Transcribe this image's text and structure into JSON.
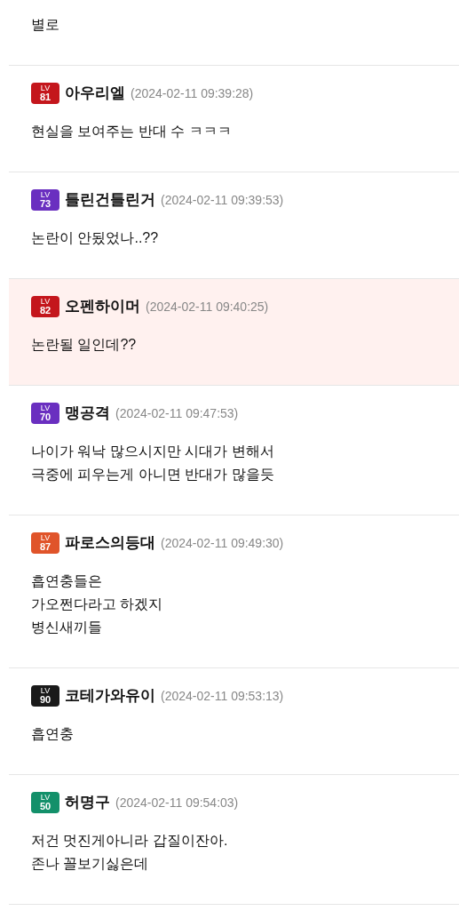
{
  "top_fragment": {
    "lines": [
      "별로"
    ]
  },
  "comments": [
    {
      "badge": {
        "label": "LV",
        "level": "81",
        "color": "#c4161c"
      },
      "name": "아우리엘",
      "time": "(2024-02-11 09:39:28)",
      "lines": [
        "현실을 보여주는 반대 수 ㅋㅋㅋ"
      ],
      "highlighted": false
    },
    {
      "badge": {
        "label": "LV",
        "level": "73",
        "color": "#6a2fc0"
      },
      "name": "틀린건틀린거",
      "time": "(2024-02-11 09:39:53)",
      "lines": [
        "논란이 안됬었나..??"
      ],
      "highlighted": false
    },
    {
      "badge": {
        "label": "LV",
        "level": "82",
        "color": "#c4161c"
      },
      "name": "오펜하이머",
      "time": "(2024-02-11 09:40:25)",
      "lines": [
        "논란될 일인데??"
      ],
      "highlighted": true
    },
    {
      "badge": {
        "label": "LV",
        "level": "70",
        "color": "#6a2fc0"
      },
      "name": "맹공격",
      "time": "(2024-02-11 09:47:53)",
      "lines": [
        "나이가 워낙 많으시지만 시대가 변해서",
        "극중에 피우는게 아니면 반대가 많을듯"
      ],
      "highlighted": false
    },
    {
      "badge": {
        "label": "LV",
        "level": "87",
        "color": "#e0542a"
      },
      "name": "파로스의등대",
      "time": "(2024-02-11 09:49:30)",
      "lines": [
        "흡연충들은",
        "가오쩐다라고 하겠지",
        "병신새끼들"
      ],
      "highlighted": false
    },
    {
      "badge": {
        "label": "LV",
        "level": "90",
        "color": "#1a1a1a"
      },
      "name": "코테가와유이",
      "time": "(2024-02-11 09:53:13)",
      "lines": [
        "흡연충"
      ],
      "highlighted": false
    },
    {
      "badge": {
        "label": "LV",
        "level": "50",
        "color": "#13906a"
      },
      "name": "허명구",
      "time": "(2024-02-11 09:54:03)",
      "lines": [
        "저건 멋진게아니라 갑질이잔아.",
        "존나 꼴보기싫은데"
      ],
      "highlighted": false
    }
  ]
}
